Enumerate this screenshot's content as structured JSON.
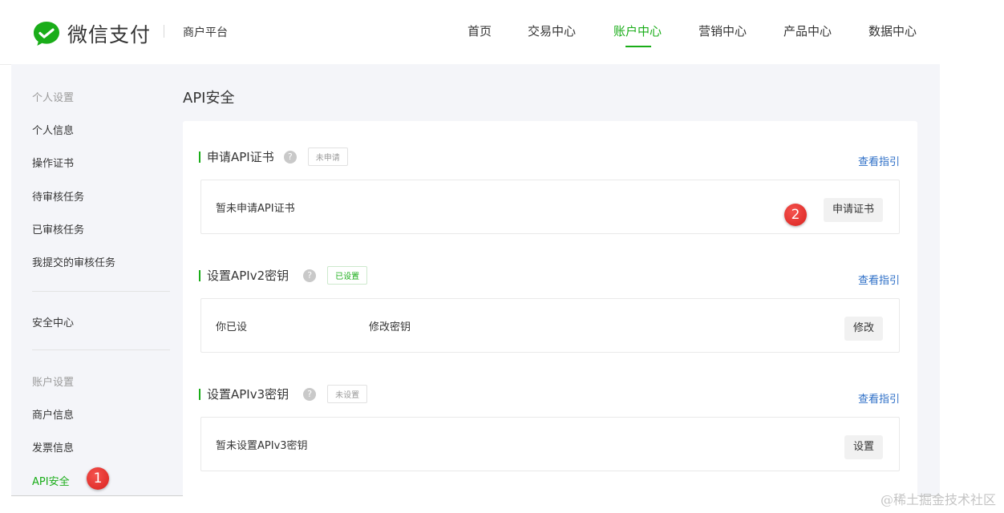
{
  "header": {
    "brand": "微信支付",
    "platform": "商户平台",
    "nav": [
      {
        "label": "首页"
      },
      {
        "label": "交易中心"
      },
      {
        "label": "账户中心"
      },
      {
        "label": "营销中心"
      },
      {
        "label": "产品中心"
      },
      {
        "label": "数据中心"
      }
    ],
    "active_nav": "账户中心",
    "accent_color": "#1aad19"
  },
  "sidebar": {
    "group_personal": "个人设置",
    "personal_items": [
      "个人信息",
      "操作证书",
      "待审核任务",
      "已审核任务",
      "我提交的审核任务"
    ],
    "security_center": "安全中心",
    "group_account": "账户设置",
    "account_items": [
      "商户信息",
      "发票信息",
      "API安全"
    ],
    "active_item": "API安全"
  },
  "main": {
    "title": "API安全",
    "sections": [
      {
        "title": "申请API证书",
        "tag": "未申请",
        "guide": "查看指引",
        "text": "暂未申请API证书",
        "button": "申请证书"
      },
      {
        "title": "设置APIv2密钥",
        "tag": "已设置",
        "guide": "查看指引",
        "text": "你已设",
        "link": "修改密钥",
        "button": "修改"
      },
      {
        "title": "设置APIv3密钥",
        "tag": "未设置",
        "guide": "查看指引",
        "text": "暂未设置APIv3密钥",
        "button": "设置"
      }
    ]
  },
  "annotations": [
    "1",
    "2"
  ],
  "watermark": "@稀土掘金技术社区"
}
